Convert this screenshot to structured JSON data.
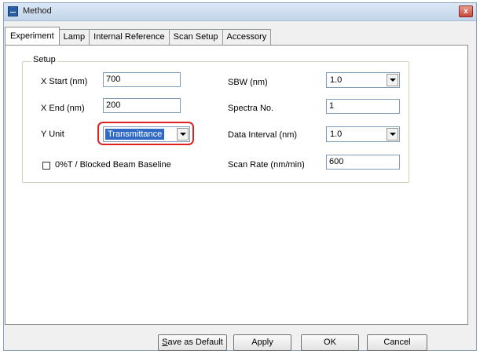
{
  "window": {
    "title": "Method",
    "close_glyph": "x"
  },
  "tabs": [
    {
      "label": "Experiment",
      "active": true
    },
    {
      "label": "Lamp",
      "active": false
    },
    {
      "label": "Internal Reference",
      "active": false
    },
    {
      "label": "Scan Setup",
      "active": false
    },
    {
      "label": "Accessory",
      "active": false
    }
  ],
  "setup": {
    "group_label": "Setup",
    "x_start": {
      "label": "X Start (nm)",
      "value": "700"
    },
    "x_end": {
      "label": "X End (nm)",
      "value": "200"
    },
    "y_unit": {
      "label": "Y Unit",
      "value": "Transmittance"
    },
    "baseline_checkbox": {
      "label": "0%T / Blocked Beam Baseline",
      "checked": false
    },
    "sbw": {
      "label": "SBW (nm)",
      "value": "1.0"
    },
    "spectra_no": {
      "label": "Spectra No.",
      "value": "1"
    },
    "data_interval": {
      "label": "Data Interval (nm)",
      "value": "1.0"
    },
    "scan_rate": {
      "label": "Scan Rate (nm/min)",
      "value": "600"
    }
  },
  "buttons": {
    "save_default_prefix": "S",
    "save_default_rest": "ave as Default",
    "apply": "Apply",
    "ok": "OK",
    "cancel": "Cancel"
  },
  "colors": {
    "selection": "#316ac5",
    "highlight_ring": "#e02020"
  }
}
